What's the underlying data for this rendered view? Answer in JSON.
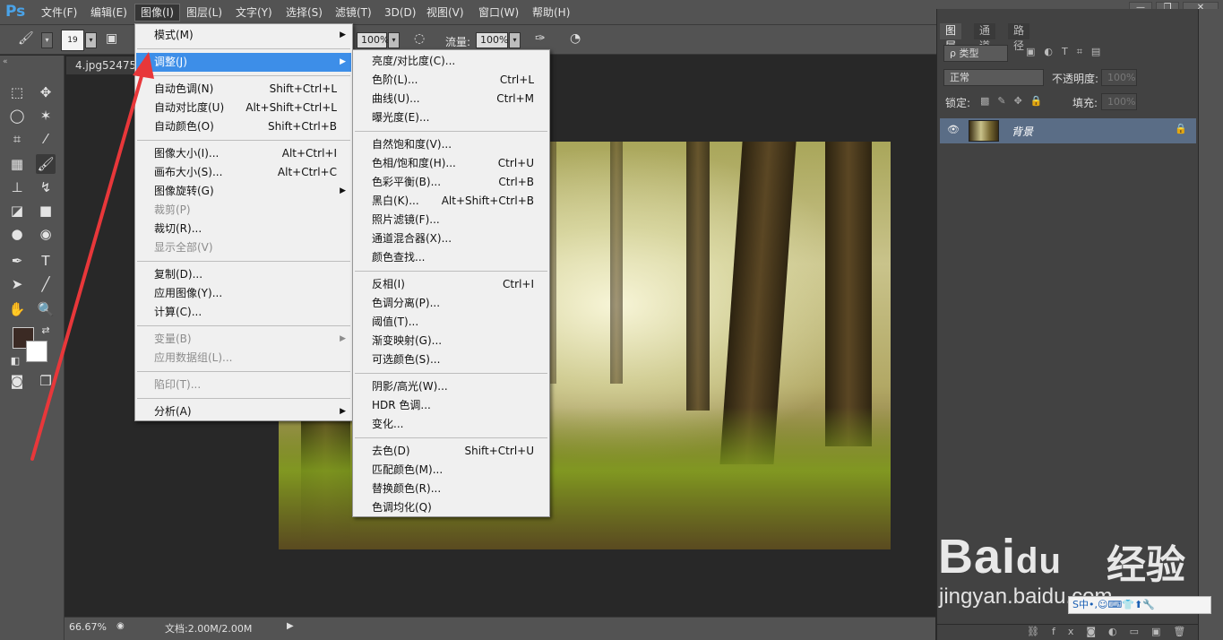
{
  "app": {
    "logo": "Ps"
  },
  "menubar": {
    "items": [
      "文件(F)",
      "编辑(E)",
      "图像(I)",
      "图层(L)",
      "文字(Y)",
      "选择(S)",
      "滤镜(T)",
      "3D(D)",
      "视图(V)",
      "窗口(W)",
      "帮助(H)"
    ],
    "active": "图像(I)"
  },
  "window_controls": {
    "minimize": "—",
    "restore": "❐",
    "close": "✕"
  },
  "options_bar": {
    "brush_size": "19",
    "opacity_value": "100%",
    "flow_label": "流量:",
    "flow_value": "100%"
  },
  "document": {
    "tab_title": "4.jpg52475-",
    "zoom": "66.67%",
    "doc_info": "文档:2.00M/2.00M"
  },
  "image_menu": [
    {
      "label": "模式(M)",
      "shortcut": "",
      "submenu": true,
      "disabled": false
    },
    {
      "sep": true
    },
    {
      "label": "调整(J)",
      "shortcut": "",
      "submenu": true,
      "disabled": false,
      "highlight": true
    },
    {
      "sep": true
    },
    {
      "label": "自动色调(N)",
      "shortcut": "Shift+Ctrl+L",
      "submenu": false,
      "disabled": false
    },
    {
      "label": "自动对比度(U)",
      "shortcut": "Alt+Shift+Ctrl+L",
      "submenu": false,
      "disabled": false
    },
    {
      "label": "自动颜色(O)",
      "shortcut": "Shift+Ctrl+B",
      "submenu": false,
      "disabled": false
    },
    {
      "sep": true
    },
    {
      "label": "图像大小(I)...",
      "shortcut": "Alt+Ctrl+I",
      "submenu": false,
      "disabled": false
    },
    {
      "label": "画布大小(S)...",
      "shortcut": "Alt+Ctrl+C",
      "submenu": false,
      "disabled": false
    },
    {
      "label": "图像旋转(G)",
      "shortcut": "",
      "submenu": true,
      "disabled": false
    },
    {
      "label": "裁剪(P)",
      "shortcut": "",
      "submenu": false,
      "disabled": true
    },
    {
      "label": "裁切(R)...",
      "shortcut": "",
      "submenu": false,
      "disabled": false
    },
    {
      "label": "显示全部(V)",
      "shortcut": "",
      "submenu": false,
      "disabled": true
    },
    {
      "sep": true
    },
    {
      "label": "复制(D)...",
      "shortcut": "",
      "submenu": false,
      "disabled": false
    },
    {
      "label": "应用图像(Y)...",
      "shortcut": "",
      "submenu": false,
      "disabled": false
    },
    {
      "label": "计算(C)...",
      "shortcut": "",
      "submenu": false,
      "disabled": false
    },
    {
      "sep": true
    },
    {
      "label": "变量(B)",
      "shortcut": "",
      "submenu": true,
      "disabled": true
    },
    {
      "label": "应用数据组(L)...",
      "shortcut": "",
      "submenu": false,
      "disabled": true
    },
    {
      "sep": true
    },
    {
      "label": "陷印(T)...",
      "shortcut": "",
      "submenu": false,
      "disabled": true
    },
    {
      "sep": true
    },
    {
      "label": "分析(A)",
      "shortcut": "",
      "submenu": true,
      "disabled": false
    }
  ],
  "adjust_menu": [
    {
      "label": "亮度/对比度(C)...",
      "shortcut": ""
    },
    {
      "label": "色阶(L)...",
      "shortcut": "Ctrl+L"
    },
    {
      "label": "曲线(U)...",
      "shortcut": "Ctrl+M"
    },
    {
      "label": "曝光度(E)...",
      "shortcut": ""
    },
    {
      "sep": true
    },
    {
      "label": "自然饱和度(V)...",
      "shortcut": ""
    },
    {
      "label": "色相/饱和度(H)...",
      "shortcut": "Ctrl+U"
    },
    {
      "label": "色彩平衡(B)...",
      "shortcut": "Ctrl+B"
    },
    {
      "label": "黑白(K)...",
      "shortcut": "Alt+Shift+Ctrl+B"
    },
    {
      "label": "照片滤镜(F)...",
      "shortcut": ""
    },
    {
      "label": "通道混合器(X)...",
      "shortcut": ""
    },
    {
      "label": "颜色查找...",
      "shortcut": ""
    },
    {
      "sep": true
    },
    {
      "label": "反相(I)",
      "shortcut": "Ctrl+I"
    },
    {
      "label": "色调分离(P)...",
      "shortcut": ""
    },
    {
      "label": "阈值(T)...",
      "shortcut": ""
    },
    {
      "label": "渐变映射(G)...",
      "shortcut": ""
    },
    {
      "label": "可选颜色(S)...",
      "shortcut": ""
    },
    {
      "sep": true
    },
    {
      "label": "阴影/高光(W)...",
      "shortcut": ""
    },
    {
      "label": "HDR 色调...",
      "shortcut": ""
    },
    {
      "label": "变化...",
      "shortcut": ""
    },
    {
      "sep": true
    },
    {
      "label": "去色(D)",
      "shortcut": "Shift+Ctrl+U"
    },
    {
      "label": "匹配颜色(M)...",
      "shortcut": ""
    },
    {
      "label": "替换颜色(R)...",
      "shortcut": ""
    },
    {
      "label": "色调均化(Q)",
      "shortcut": ""
    }
  ],
  "layers_panel": {
    "tabs": [
      "图层",
      "通道",
      "路径"
    ],
    "filter_kind": "ρ 类型",
    "blend_mode": "正常",
    "opacity_label": "不透明度:",
    "opacity_value": "100%",
    "lock_label": "锁定:",
    "fill_label": "填充:",
    "fill_value": "100%",
    "layer_name": "背景"
  },
  "watermark": {
    "brand": "Bai",
    "brand_tail": "du",
    "cn": "经验",
    "url": "jingyan.baidu.com"
  },
  "ime_bar": {
    "text": "S中•,☺⌨👕⬆🔧"
  },
  "colors": {
    "highlight": "#3d8ee8",
    "annotation_arrow": "#e8373a",
    "foreground": "#3b2a24",
    "background": "#ffffff"
  },
  "icons": [
    "brush-icon",
    "eye-icon",
    "lock-icon",
    "play-icon"
  ]
}
